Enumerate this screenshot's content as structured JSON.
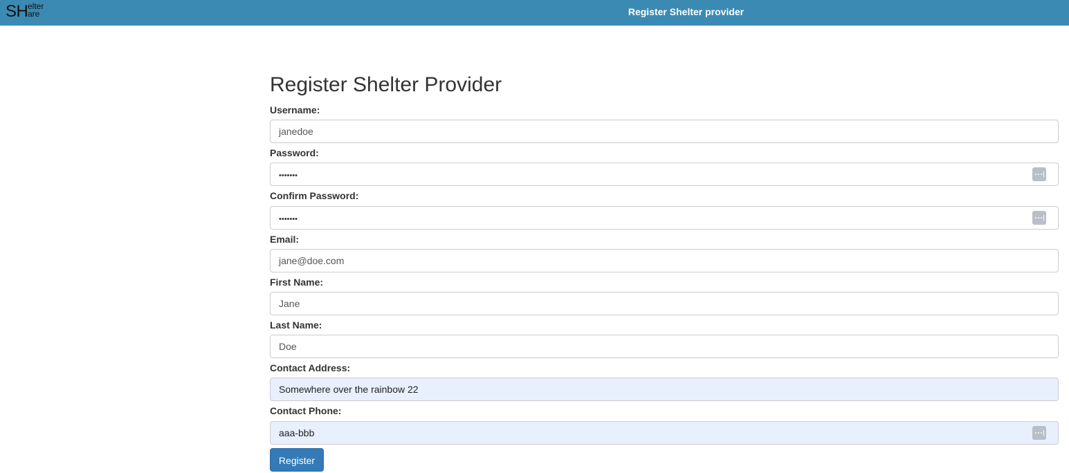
{
  "header": {
    "logo_big": "SH",
    "logo_small_1": "elter",
    "logo_small_2": "are",
    "title": "Register Shelter provider"
  },
  "form": {
    "title": "Register Shelter Provider",
    "fields": {
      "username": {
        "label": "Username:",
        "value": "janedoe"
      },
      "password": {
        "label": "Password:",
        "value": "•••••••"
      },
      "confirm_password": {
        "label": "Confirm Password:",
        "value": "•••••••"
      },
      "email": {
        "label": "Email:",
        "value": "jane@doe.com"
      },
      "first_name": {
        "label": "First Name:",
        "value": "Jane"
      },
      "last_name": {
        "label": "Last Name:",
        "value": "Doe"
      },
      "contact_address": {
        "label": "Contact Address:",
        "value": "Somewhere over the rainbow 22"
      },
      "contact_phone": {
        "label": "Contact Phone:",
        "value": "aaa-bbb"
      }
    },
    "submit_label": "Register"
  },
  "colors": {
    "header_bg": "#3b8ab4",
    "button_bg": "#337ab7",
    "autofill_bg": "#e8f0fe"
  },
  "icons": {
    "password_manager": "password-manager-key-icon"
  }
}
